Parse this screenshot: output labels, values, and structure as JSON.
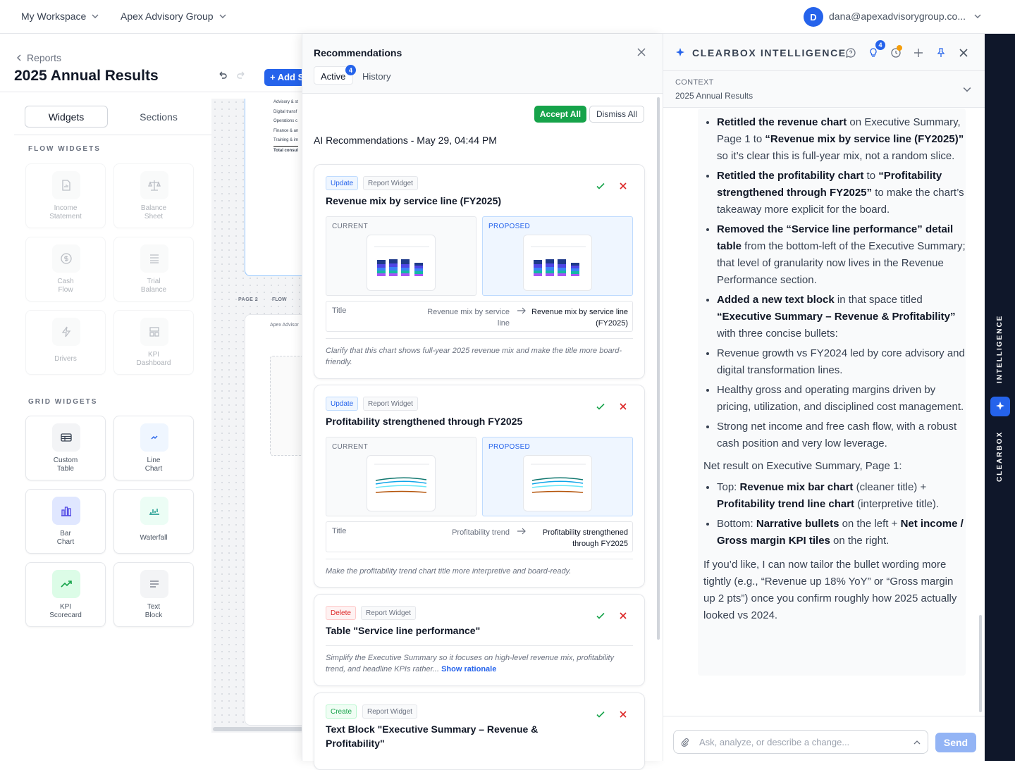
{
  "topbar": {
    "workspace": "My Workspace",
    "org": "Apex Advisory Group",
    "avatar_initial": "D",
    "user_email": "dana@apexadvisorygroup.co..."
  },
  "editor": {
    "breadcrumb": "Reports",
    "title": "2025 Annual Results",
    "add_section": "+ Add Se",
    "tabs": {
      "widgets": "Widgets",
      "sections": "Sections"
    },
    "flow_heading": "FLOW WIDGETS",
    "flow_widgets": [
      {
        "l1": "Income",
        "l2": "Statement",
        "icon": "income-statement-icon"
      },
      {
        "l1": "Balance",
        "l2": "Sheet",
        "icon": "balance-scale-icon"
      },
      {
        "l1": "Cash",
        "l2": "Flow",
        "icon": "dollar-icon"
      },
      {
        "l1": "Trial",
        "l2": "Balance",
        "icon": "list-icon"
      },
      {
        "l1": "Drivers",
        "l2": "",
        "icon": "bolt-icon"
      },
      {
        "l1": "KPI",
        "l2": "Dashboard",
        "icon": "dashboard-icon"
      }
    ],
    "grid_heading": "GRID WIDGETS",
    "grid_widgets": [
      {
        "l1": "Custom",
        "l2": "Table",
        "icon": "table-icon"
      },
      {
        "l1": "Line",
        "l2": "Chart",
        "icon": "line-chart-icon"
      },
      {
        "l1": "Bar",
        "l2": "Chart",
        "icon": "bar-chart-icon"
      },
      {
        "l1": "Waterfall",
        "l2": "",
        "icon": "waterfall-icon"
      },
      {
        "l1": "KPI",
        "l2": "Scorecard",
        "icon": "trend-up-icon"
      },
      {
        "l1": "Text",
        "l2": "Block",
        "icon": "text-icon"
      }
    ],
    "canvas": {
      "page1_rows": [
        "Advisory & st",
        "Digital transf",
        "Operations c",
        "Finance & an",
        "Training & im",
        "Total consul"
      ],
      "page2_label": "PAGE 2",
      "flow_label": "FLOW",
      "page2_header": "Apex Advisor"
    }
  },
  "recs": {
    "title": "Recommendations",
    "tab_active": "Active",
    "active_count": "4",
    "tab_history": "History",
    "accept_all": "Accept All",
    "dismiss_all": "Dismiss All",
    "run_heading": "AI Recommendations - May 29, 04:44 PM",
    "current_label": "CURRENT",
    "proposed_label": "PROPOSED",
    "cards": [
      {
        "action": "Update",
        "kind": "Report Widget",
        "title": "Revenue mix by service line (FY2025)",
        "field": "Title",
        "old": "Revenue mix by service line",
        "new": "Revenue mix by service line (FY2025)",
        "rationale": "Clarify that this chart shows full-year 2025 revenue mix and make the title more board-friendly."
      },
      {
        "action": "Update",
        "kind": "Report Widget",
        "title": "Profitability strengthened through FY2025",
        "field": "Title",
        "old": "Profitability trend",
        "new": "Profitability strengthened through FY2025",
        "rationale": "Make the profitability trend chart title more interpretive and board-ready."
      },
      {
        "action": "Delete",
        "kind": "Report Widget",
        "title": "Table \"Service line performance\"",
        "rationale": "Simplify the Executive Summary so it focuses on high-level revenue mix, profitability trend, and headline KPIs rather...",
        "show_rationale": "Show rationale"
      },
      {
        "action": "Create",
        "kind": "Report Widget",
        "title": "Text Block \"Executive Summary – Revenue & Profitability\""
      }
    ]
  },
  "ai": {
    "title": "CLEARBOX INTELLIGENCE",
    "bulb_count": "4",
    "context_label": "CONTEXT",
    "context_value": "2025 Annual Results",
    "message": {
      "b1_bold": "Retitled the revenue chart",
      "b1_a": " on Executive Summary, Page 1 to ",
      "b1_bold2": "“Revenue mix by service line (FY2025)”",
      "b1_b": " so it’s clear this is full-year mix, not a random slice.",
      "b2_bold": "Retitled the profitability chart",
      "b2_a": " to ",
      "b2_bold2": "“Profitability strengthened through FY2025”",
      "b2_b": " to make the chart’s takeaway more explicit for the board.",
      "b3_bold": "Removed the “Service line performance” detail table",
      "b3_a": " from the bottom-left of the Executive Summary; that level of granularity now lives in the Revenue Performance section.",
      "b4_bold": "Added a new text block",
      "b4_a": " in that space titled ",
      "b4_bold2": "“Executive Summary – Revenue & Profitability”",
      "b4_b": " with three concise bullets:",
      "b5": "Revenue growth vs FY2024 led by core advisory and digital transformation lines.",
      "b6": "Healthy gross and operating margins driven by pricing, utilization, and disciplined cost management.",
      "b7": "Strong net income and free cash flow, with a robust cash position and very low leverage.",
      "net_result": "Net result on Executive Summary, Page 1:",
      "top_a": "Top: ",
      "top_bold": "Revenue mix bar chart",
      "top_b": " (cleaner title) + ",
      "top_bold2": "Profitability trend line chart",
      "top_c": " (interpretive title).",
      "bot_a": "Bottom: ",
      "bot_bold": "Narrative bullets",
      "bot_b": " on the left + ",
      "bot_bold2": "Net income / Gross margin KPI tiles",
      "bot_c": " on the right.",
      "closing": "If you’d like, I can now tailor the bullet wording more tightly (e.g., “Revenue up 18% YoY” or “Gross margin up 2 pts”) once you confirm roughly how 2025 actually looked vs 2024."
    },
    "input_placeholder": "Ask, analyze, or describe a change...",
    "send": "Send"
  },
  "rail": {
    "intelligence": "INTELLIGENCE",
    "clearbox": "CLEARBOX"
  },
  "colors": {
    "accent": "#2563eb",
    "accept": "#16a34a",
    "reject": "#dc2626",
    "rail": "#0f172a"
  }
}
